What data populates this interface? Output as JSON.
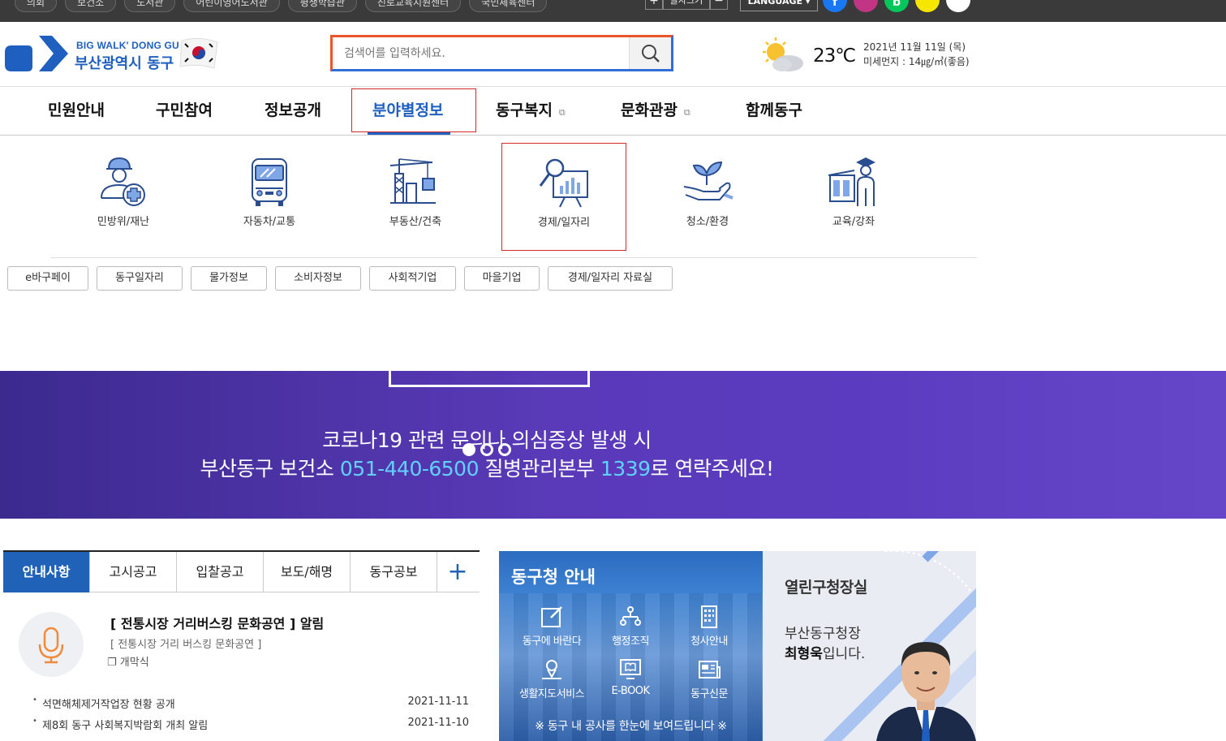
{
  "topbar": {
    "links": [
      "의회",
      "보건소",
      "도서관",
      "어린이영어도서관",
      "평생학습관",
      "진로교육지원센터",
      "국민체육센터"
    ],
    "zoom_in": "+",
    "zoom_label": "글자크기",
    "zoom_out": "−",
    "language": "LANGUAGE ▾",
    "sns": [
      "f",
      "",
      "b",
      "",
      ""
    ]
  },
  "header": {
    "logo_sub": "BIG WALK' DONG GU",
    "logo_main": "부산광역시 동구",
    "search_placeholder": "검색어를 입력하세요.",
    "weather": {
      "temperature": "23℃",
      "date": "2021년 11월 11일 (목)",
      "dust": "미세먼지 : 14㎍/㎥(좋음)"
    }
  },
  "gnb": {
    "items": [
      "민원안내",
      "구민참여",
      "정보공개",
      "분야별정보",
      "동구복지",
      "문화관광",
      "함께동구"
    ],
    "active": "분야별정보"
  },
  "submenu": {
    "categories": [
      "민방위/재난",
      "자동차/교통",
      "부동산/건축",
      "경제/일자리",
      "청소/환경",
      "교육/강좌"
    ],
    "selected": "경제/일자리",
    "chips": [
      "e바구페이",
      "동구일자리",
      "물가정보",
      "소비자정보",
      "사회적기업",
      "마을기업",
      "경제/일자리 자료실"
    ]
  },
  "banner": {
    "line1": "코로나19 관련 문의나 의심증상 발생 시",
    "line2_pre": "부산동구 보건소 ",
    "line2_phone1": "051-440-6500",
    "line2_mid": "  질병관리본부 ",
    "line2_phone2": "1339",
    "line2_post": "로 연락주세요!"
  },
  "notice": {
    "tabs": [
      "안내사항",
      "고시공고",
      "입찰공고",
      "보도/해명",
      "동구공보"
    ],
    "plus": "+",
    "featured_title": "[ 전통시장 거리버스킹 문화공연 ]  알림",
    "featured_sub": "[ 전통시장 거리 버스킹 문화공연 ]",
    "featured_sub2": "❐ 개막식",
    "items": [
      {
        "title": "석면해체제거작업장 현황 공개",
        "date": "2021-11-11"
      },
      {
        "title": "제8회 동구 사회복지박람회 개최 알림",
        "date": "2021-11-10"
      }
    ]
  },
  "info": {
    "title": "동구청 안내",
    "icons": [
      "동구에 바란다",
      "행정조직",
      "청사안내",
      "생활지도서비스",
      "E-BOOK",
      "동구신문"
    ],
    "footer": "※ 동구 내 공사를 한눈에 보여드립니다 ※"
  },
  "mayor": {
    "heading": "열린구청장실",
    "line1": "부산동구청장",
    "name": "최형욱",
    "line2_suffix": "입니다."
  }
}
